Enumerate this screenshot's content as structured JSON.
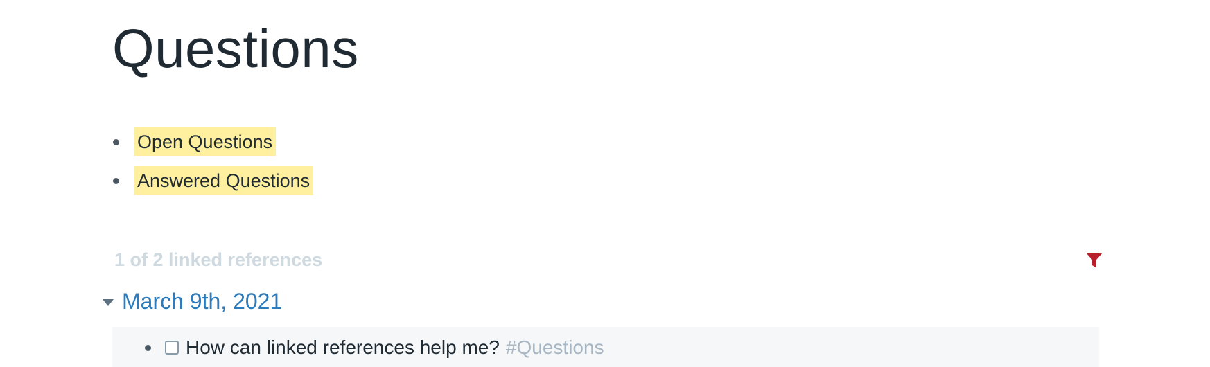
{
  "page": {
    "title": "Questions"
  },
  "bullets": [
    {
      "label": "Open Questions"
    },
    {
      "label": "Answered Questions"
    }
  ],
  "linked_references": {
    "header": "1 of 2 linked references",
    "filter_icon": "filter-icon",
    "filter_color": "#b8202b",
    "groups": [
      {
        "title": "March 9th, 2021",
        "blocks": [
          {
            "checked": false,
            "text": "How can linked references help me?",
            "tag": "#Questions"
          }
        ]
      }
    ]
  },
  "colors": {
    "highlight": "#fff0a0",
    "link": "#2b7bbd",
    "tag": "#a7b6c2",
    "muted_header": "#ced9e0"
  }
}
